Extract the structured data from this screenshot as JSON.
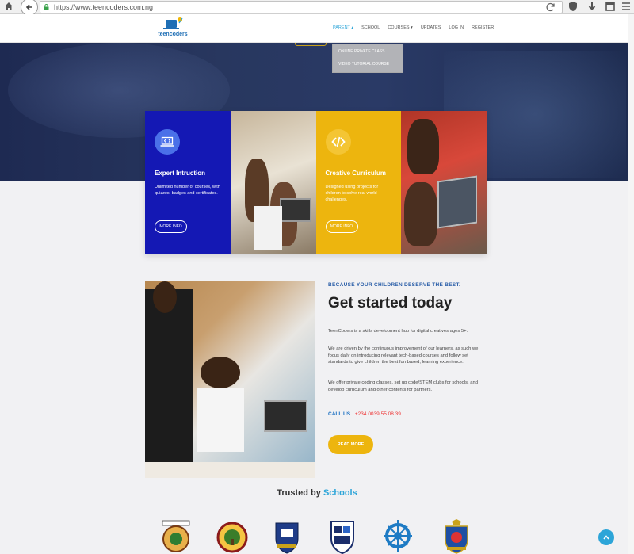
{
  "browser": {
    "url": "https://www.teencoders.com.ng"
  },
  "header": {
    "logo_text": "teencoders",
    "nav": [
      {
        "label": "PARENT ▴"
      },
      {
        "label": "SCHOOL"
      },
      {
        "label": "COURSES ▾"
      },
      {
        "label": "UPDATES"
      },
      {
        "label": "LOG IN"
      },
      {
        "label": "REGISTER"
      }
    ],
    "dropdown": [
      {
        "label": "ONLINE PRIVATE CLASS"
      },
      {
        "label": "VIDEO TUTORIAL COURSE"
      }
    ]
  },
  "cards": [
    {
      "title": "Expert Intruction",
      "desc": "Unlimited number of courses, with quizzes, badges and certificates.",
      "button": "MORE INFO",
      "icon": "laptop-code-icon"
    },
    {
      "title": "Creative Curriculum",
      "desc": "Designed using projects for children to solve real world challenges.",
      "button": "MORE INFO",
      "icon": "code-brackets-icon"
    }
  ],
  "about": {
    "tagline": "BECAUSE YOUR CHILDREN DESERVE THE BEST.",
    "heading": "Get started today",
    "para1": "TeenCoders is a skills development hub for digital creatives ages 5+.",
    "para2": "We are driven by the continuous improvement of our learners, as such we focus daily on introducing relevant tech-based courses and follow set standards to give children the best fun based, learning experience.",
    "para3": "We offer private coding classes, set up code/STEM clubs for schools, and develop curriculum and other contents for partners.",
    "call_label": "CALL US",
    "phone": "+234 0039 55 08 39",
    "button": "READ MORE"
  },
  "trusted": {
    "prefix": "Trusted by",
    "highlight": "Schools"
  },
  "colors": {
    "blue_card": "#1418b4",
    "yellow_card": "#edb50e",
    "accent": "#2da5d8"
  }
}
